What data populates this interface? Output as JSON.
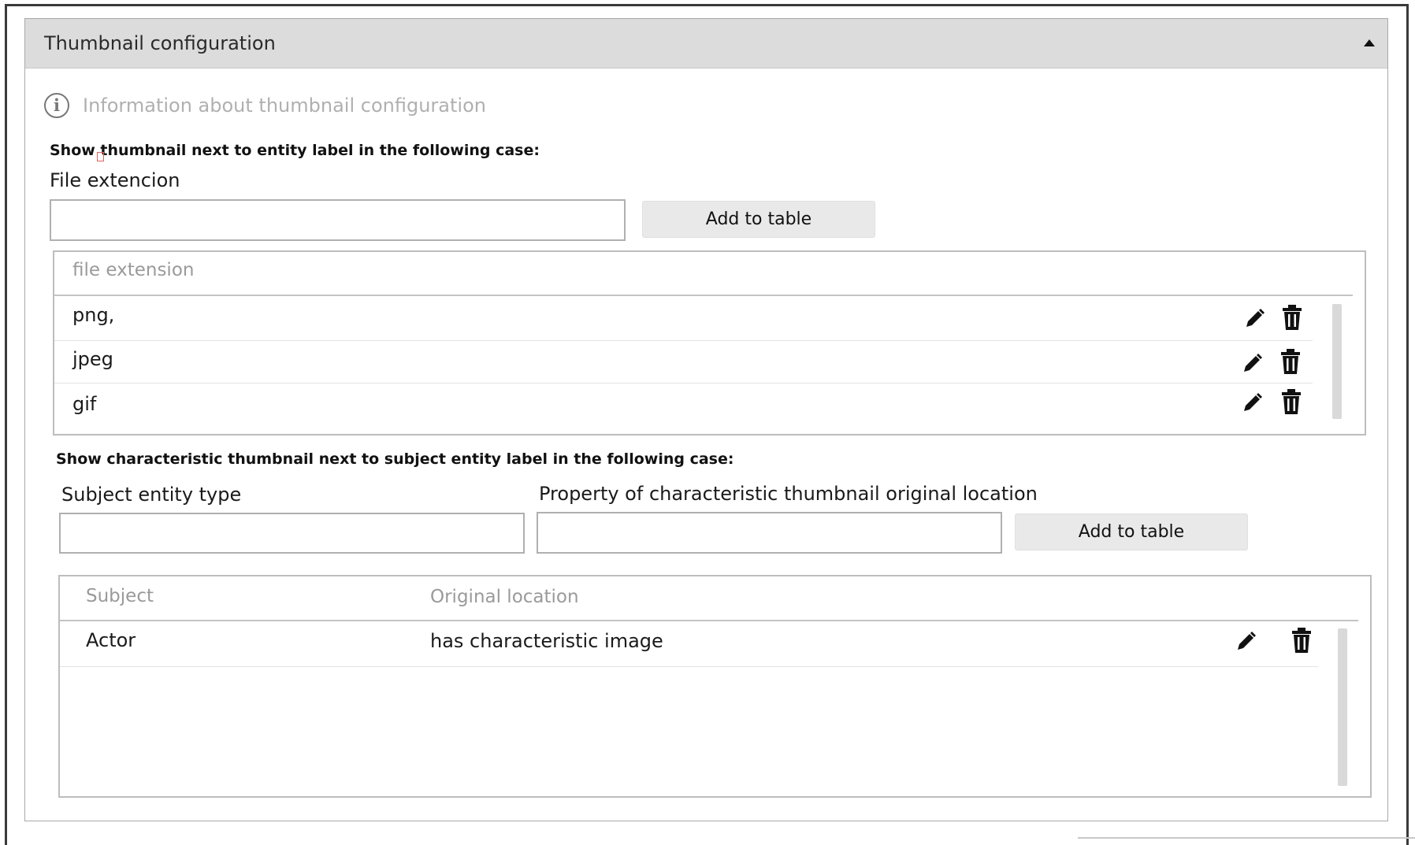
{
  "panel": {
    "title": "Thumbnail configuration",
    "collapse_icon": "caret-up-icon"
  },
  "info": {
    "icon": "info-circle-icon",
    "text": "Information about thumbnail configuration"
  },
  "section1": {
    "title": "Show thumbnail next to entity label in the following case:",
    "field_label": "File extencion",
    "input_value": "",
    "add_button": "Add to table",
    "table": {
      "header": "file extension",
      "rows": [
        "png,",
        "jpeg",
        "gif"
      ]
    }
  },
  "section2": {
    "title": "Show characteristic thumbnail next to subject entity label in the following case:",
    "subject_label": "Subject entity type",
    "subject_value": "",
    "property_label": "Property of characteristic thumbnail original location",
    "property_value": "",
    "add_button": "Add to table",
    "table": {
      "headers": [
        "Subject",
        "Original location"
      ],
      "rows": [
        {
          "subject": "Actor",
          "location": "has characteristic image"
        }
      ]
    }
  },
  "icons": {
    "edit": "pencil-icon",
    "delete": "trash-icon"
  }
}
